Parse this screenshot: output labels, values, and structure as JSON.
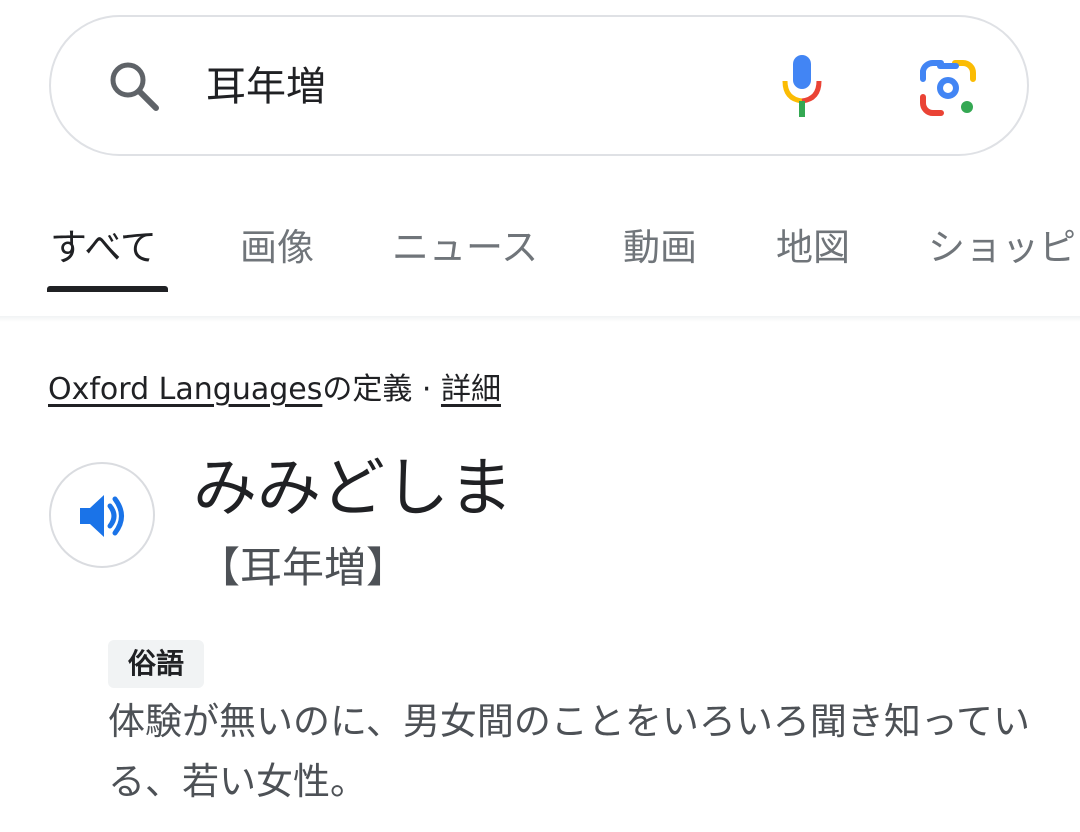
{
  "search": {
    "query": "耳年増",
    "icons": {
      "search": "search-icon",
      "voice": "microphone-icon",
      "lens": "google-lens-icon"
    }
  },
  "tabs": [
    {
      "label": "すべて",
      "active": true
    },
    {
      "label": "画像"
    },
    {
      "label": "ニュース"
    },
    {
      "label": "動画"
    },
    {
      "label": "地図"
    },
    {
      "label": "ショッピ"
    }
  ],
  "dictionary": {
    "source_link": "Oxford Languages",
    "source_suffix": "の定義",
    "separator": " · ",
    "details_link": "詳細",
    "headword": "みみどしま",
    "kanji": "【耳年増】",
    "label": "俗語",
    "definition": "体験が無いのに、男女間のことをいろいろ聞き知っている、若い女性。",
    "audio_icon": "speaker-icon"
  },
  "colors": {
    "google_blue": "#4285f4",
    "google_red": "#ea4335",
    "google_yellow": "#fbbc04",
    "google_green": "#34a853",
    "speaker_blue": "#1a73e8"
  }
}
